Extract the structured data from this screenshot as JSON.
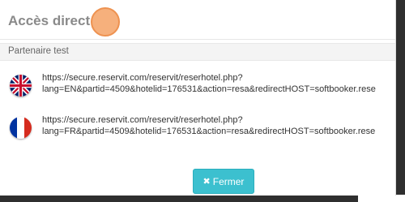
{
  "dialog": {
    "title": "Accès direct",
    "section_label": "Partenaire test",
    "links": [
      {
        "flag": "uk-flag-icon",
        "line1": "https://secure.reservit.com/reservit/reserhotel.php?",
        "line2": "lang=EN&partid=4509&hotelid=176531&action=resa&redirectHOST=softbooker.rese"
      },
      {
        "flag": "france-flag-icon",
        "line1": "https://secure.reservit.com/reservit/reserhotel.php?",
        "line2": "lang=FR&partid=4509&hotelid=176531&action=resa&redirectHOST=softbooker.rese"
      }
    ],
    "close_button": {
      "icon": "✖",
      "label": "Fermer"
    }
  },
  "colors": {
    "button_bg": "#3cc0cf",
    "title_text": "#8a8a8a",
    "cursor_marker": "#f6b07c"
  }
}
